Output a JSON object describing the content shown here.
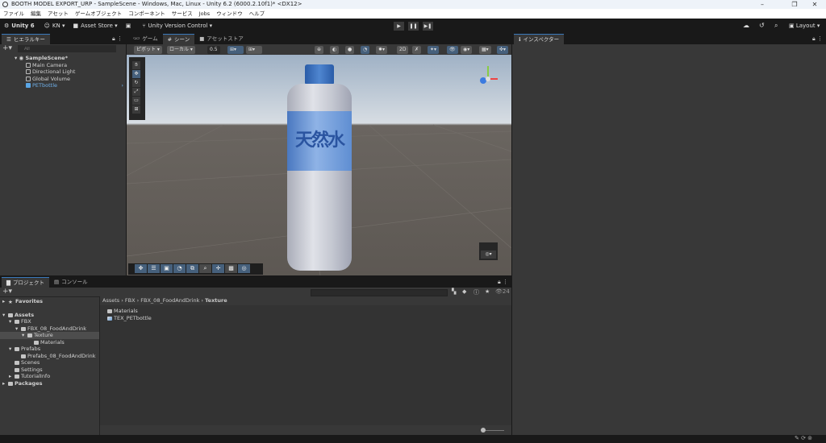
{
  "window": {
    "title": "BOOTH MODEL EXPORT_URP - SampleScene - Windows, Mac, Linux - Unity 6.2 (6000.2.10f1)* <DX12>",
    "minimize": "–",
    "maximize": "❐",
    "close": "✕"
  },
  "menu": [
    "ファイル",
    "編集",
    "アセット",
    "ゲームオブジェクト",
    "コンポーネント",
    "サービス",
    "Jobs",
    "ウィンドウ",
    "ヘルプ"
  ],
  "toolbar": {
    "unity": "Unity 6",
    "account": "KN ▾",
    "asset_store": "Asset Store ▾",
    "version_control": "Unity Version Control ▾",
    "layout": "Layout ▾",
    "play": "▶",
    "pause": "❚❚",
    "step": "▶❚"
  },
  "hierarchy": {
    "tab": "ヒエラルキー",
    "search_placeholder": "All",
    "scene": "SampleScene*",
    "items": [
      "Main Camera",
      "Directional Light",
      "Global Volume",
      "PETbottle"
    ]
  },
  "scene_tabs": [
    {
      "label": "ゲーム"
    },
    {
      "label": "シーン"
    },
    {
      "label": "アセットストア"
    }
  ],
  "scene_toolbar": {
    "pivot": "ピボット ▾",
    "local": "ローカル ▾",
    "snap": "0.5"
  },
  "viewport": {
    "bottle_label": "天然水"
  },
  "inspector": {
    "tab": "インスペクター"
  },
  "project": {
    "tabs": [
      "プロジェクト",
      "コンソール"
    ],
    "hidden_count": "24",
    "breadcrumb": [
      "Assets",
      "FBX",
      "FBX_08_FoodAndDrink",
      "Texture"
    ],
    "tree": [
      {
        "label": "Favorites",
        "depth": 0,
        "bold": true,
        "arrow": "▸"
      },
      {
        "label": "",
        "depth": 0
      },
      {
        "label": "Assets",
        "depth": 0,
        "bold": true,
        "arrow": "▾"
      },
      {
        "label": "FBX",
        "depth": 1,
        "arrow": "▾"
      },
      {
        "label": "FBX_08_FoodAndDrink",
        "depth": 2,
        "arrow": "▾"
      },
      {
        "label": "Texture",
        "depth": 3,
        "arrow": "▾",
        "sel": true
      },
      {
        "label": "Materials",
        "depth": 4
      },
      {
        "label": "Prefabs",
        "depth": 1,
        "arrow": "▾"
      },
      {
        "label": "Prefabs_08_FoodAndDrink",
        "depth": 2
      },
      {
        "label": "Scenes",
        "depth": 1
      },
      {
        "label": "Settings",
        "depth": 1
      },
      {
        "label": "TutorialInfo",
        "depth": 1,
        "arrow": "▸"
      },
      {
        "label": "Packages",
        "depth": 0,
        "bold": true,
        "arrow": "▸"
      }
    ],
    "files": [
      {
        "label": "Materials",
        "type": "folder"
      },
      {
        "label": "TEX_PETbottle",
        "type": "texture"
      }
    ]
  }
}
